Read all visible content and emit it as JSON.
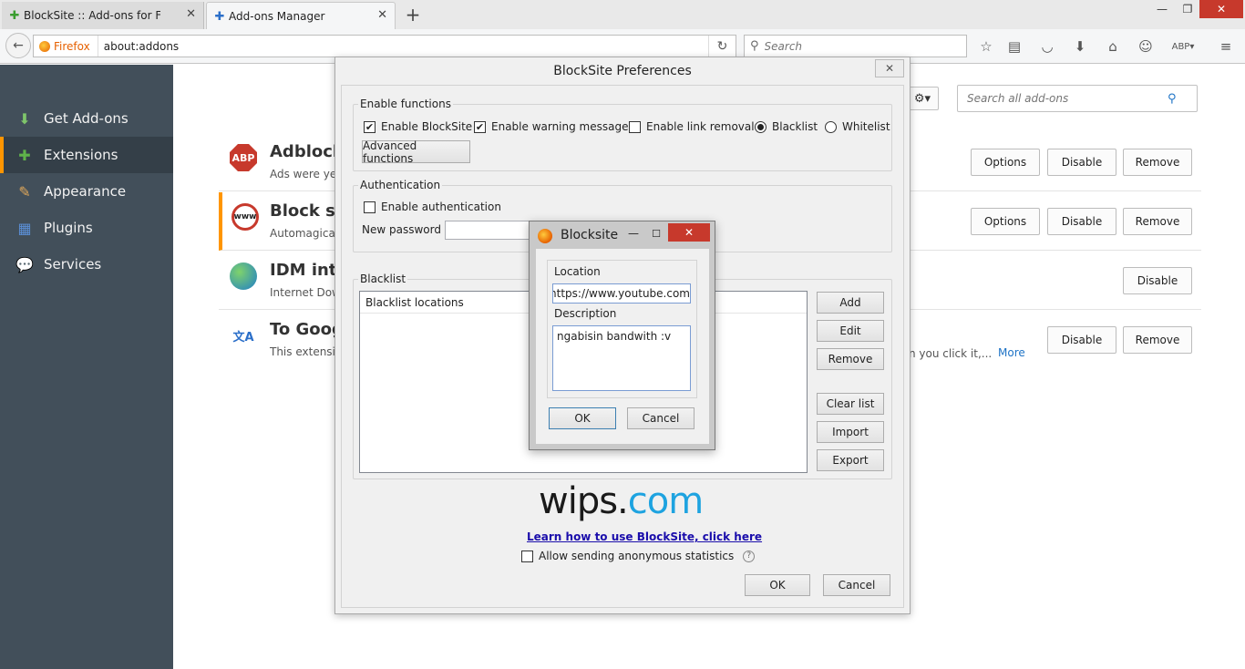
{
  "tabs": [
    {
      "label": "BlockSite :: Add-ons for Fi...",
      "icon": "puzzle-green-icon"
    },
    {
      "label": "Add-ons Manager",
      "icon": "puzzle-blue-icon"
    }
  ],
  "navbar": {
    "identity": "Firefox",
    "url": "about:addons",
    "search_placeholder": "Search"
  },
  "sidebar": {
    "items": [
      {
        "label": "Get Add-ons",
        "icon": "get-addons-icon"
      },
      {
        "label": "Extensions",
        "icon": "extensions-icon"
      },
      {
        "label": "Appearance",
        "icon": "appearance-icon"
      },
      {
        "label": "Plugins",
        "icon": "plugins-icon"
      },
      {
        "label": "Services",
        "icon": "services-icon"
      }
    ]
  },
  "addons": {
    "search_placeholder": "Search all add-ons",
    "items": [
      {
        "name": "Adblock",
        "desc": "Ads were yest",
        "icon_text": "ABP"
      },
      {
        "name": "Block sit",
        "desc": "Automagicall",
        "icon_text": "www"
      },
      {
        "name": "IDM inte",
        "desc": "Internet Down",
        "icon_text": ""
      },
      {
        "name": "To Goog",
        "desc": "This extension",
        "desc_tail": "n you click it,...",
        "icon_text": "文A"
      }
    ],
    "buttons": {
      "options": "Options",
      "disable": "Disable",
      "remove": "Remove"
    },
    "more": "More"
  },
  "prefs": {
    "title": "BlockSite Preferences",
    "close": "✕",
    "enable_functions": {
      "label": "Enable functions",
      "enable_blocksite": "Enable BlockSite",
      "enable_warning": "Enable warning messages",
      "enable_link_removal": "Enable link removal",
      "blacklist": "Blacklist",
      "whitelist": "Whitelist",
      "advanced": "Advanced functions"
    },
    "authentication": {
      "label": "Authentication",
      "enable": "Enable authentication",
      "new_password": "New password"
    },
    "blacklist": {
      "label": "Blacklist",
      "header": "Blacklist locations",
      "add": "Add",
      "edit": "Edit",
      "remove": "Remove",
      "clear": "Clear list",
      "import": "Import",
      "export": "Export"
    },
    "logo_part1": "wips.",
    "logo_part2": "com",
    "learn_link": "Learn how to use BlockSite, click here",
    "anon_stats": "Allow sending anonymous statistics",
    "ok": "OK",
    "cancel": "Cancel"
  },
  "popup": {
    "title": "Blocksite",
    "location_label": "Location",
    "location_value": "https://www.youtube.com/",
    "description_label": "Description",
    "description_value": "ngabisin bandwith :v",
    "ok": "OK",
    "cancel": "Cancel"
  }
}
